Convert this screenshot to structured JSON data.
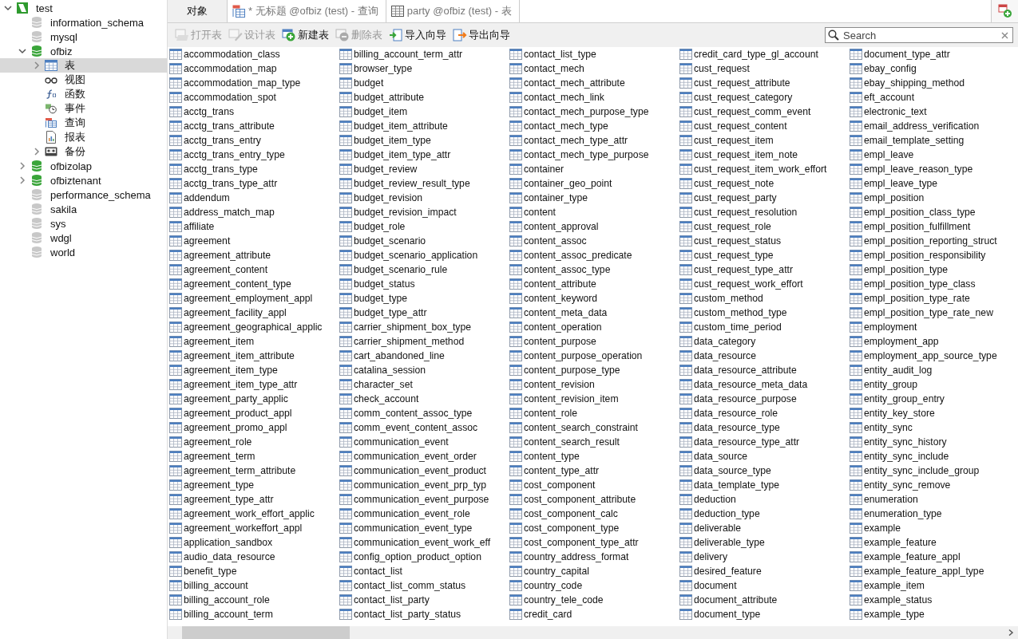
{
  "sidebar": {
    "tree": [
      {
        "label": "test",
        "kind": "connection",
        "expanded": true,
        "selected": false,
        "children": [
          {
            "label": "information_schema",
            "kind": "database",
            "connected": false,
            "selected": false
          },
          {
            "label": "mysql",
            "kind": "database",
            "connected": false,
            "selected": false
          },
          {
            "label": "ofbiz",
            "kind": "database",
            "connected": true,
            "expanded": true,
            "selected": false,
            "children": [
              {
                "label": "表",
                "kind": "tables",
                "expanded": false,
                "selected": true
              },
              {
                "label": "视图",
                "kind": "views",
                "selected": false
              },
              {
                "label": "函数",
                "kind": "functions",
                "selected": false
              },
              {
                "label": "事件",
                "kind": "events",
                "selected": false
              },
              {
                "label": "查询",
                "kind": "queries",
                "selected": false
              },
              {
                "label": "报表",
                "kind": "reports",
                "selected": false
              },
              {
                "label": "备份",
                "kind": "backups",
                "expanded": false,
                "selected": false
              }
            ]
          },
          {
            "label": "ofbizolap",
            "kind": "database",
            "connected": true,
            "expanded": false,
            "selected": false
          },
          {
            "label": "ofbiztenant",
            "kind": "database",
            "connected": true,
            "expanded": false,
            "selected": false
          },
          {
            "label": "performance_schema",
            "kind": "database",
            "connected": false,
            "selected": false
          },
          {
            "label": "sakila",
            "kind": "database",
            "connected": false,
            "selected": false
          },
          {
            "label": "sys",
            "kind": "database",
            "connected": false,
            "selected": false
          },
          {
            "label": "wdgl",
            "kind": "database",
            "connected": false,
            "selected": false
          },
          {
            "label": "world",
            "kind": "database",
            "connected": false,
            "selected": false
          }
        ]
      }
    ]
  },
  "tabs": [
    {
      "label": "对象",
      "kind": "objects",
      "selected": true
    },
    {
      "label": "* 无标题 @ofbiz (test) - 查询",
      "kind": "query",
      "selected": false
    },
    {
      "label": "party @ofbiz (test) - 表",
      "kind": "table",
      "selected": false
    }
  ],
  "toolbar": [
    {
      "label": "打开表",
      "kind": "open",
      "disabled": true
    },
    {
      "label": "设计表",
      "kind": "design",
      "disabled": true
    },
    {
      "label": "新建表",
      "kind": "new",
      "disabled": false
    },
    {
      "label": "删除表",
      "kind": "delete",
      "disabled": true
    },
    {
      "label": "导入向导",
      "kind": "import",
      "disabled": false
    },
    {
      "label": "导出向导",
      "kind": "export",
      "disabled": false
    }
  ],
  "search": {
    "placeholder": "Search"
  },
  "tables": [
    "accommodation_class",
    "accommodation_map",
    "accommodation_map_type",
    "accommodation_spot",
    "acctg_trans",
    "acctg_trans_attribute",
    "acctg_trans_entry",
    "acctg_trans_entry_type",
    "acctg_trans_type",
    "acctg_trans_type_attr",
    "addendum",
    "address_match_map",
    "affiliate",
    "agreement",
    "agreement_attribute",
    "agreement_content",
    "agreement_content_type",
    "agreement_employment_appl",
    "agreement_facility_appl",
    "agreement_geographical_applic",
    "agreement_item",
    "agreement_item_attribute",
    "agreement_item_type",
    "agreement_item_type_attr",
    "agreement_party_applic",
    "agreement_product_appl",
    "agreement_promo_appl",
    "agreement_role",
    "agreement_term",
    "agreement_term_attribute",
    "agreement_type",
    "agreement_type_attr",
    "agreement_work_effort_applic",
    "agreement_workeffort_appl",
    "application_sandbox",
    "audio_data_resource",
    "benefit_type",
    "billing_account",
    "billing_account_role",
    "billing_account_term",
    "billing_account_term_attr",
    "browser_type",
    "budget",
    "budget_attribute",
    "budget_item",
    "budget_item_attribute",
    "budget_item_type",
    "budget_item_type_attr",
    "budget_review",
    "budget_review_result_type",
    "budget_revision",
    "budget_revision_impact",
    "budget_role",
    "budget_scenario",
    "budget_scenario_application",
    "budget_scenario_rule",
    "budget_status",
    "budget_type",
    "budget_type_attr",
    "carrier_shipment_box_type",
    "carrier_shipment_method",
    "cart_abandoned_line",
    "catalina_session",
    "character_set",
    "check_account",
    "comm_content_assoc_type",
    "comm_event_content_assoc",
    "communication_event",
    "communication_event_order",
    "communication_event_product",
    "communication_event_prp_typ",
    "communication_event_purpose",
    "communication_event_role",
    "communication_event_type",
    "communication_event_work_eff",
    "config_option_product_option",
    "contact_list",
    "contact_list_comm_status",
    "contact_list_party",
    "contact_list_party_status",
    "contact_list_type",
    "contact_mech",
    "contact_mech_attribute",
    "contact_mech_link",
    "contact_mech_purpose_type",
    "contact_mech_type",
    "contact_mech_type_attr",
    "contact_mech_type_purpose",
    "container",
    "container_geo_point",
    "container_type",
    "content",
    "content_approval",
    "content_assoc",
    "content_assoc_predicate",
    "content_assoc_type",
    "content_attribute",
    "content_keyword",
    "content_meta_data",
    "content_operation",
    "content_purpose",
    "content_purpose_operation",
    "content_purpose_type",
    "content_revision",
    "content_revision_item",
    "content_role",
    "content_search_constraint",
    "content_search_result",
    "content_type",
    "content_type_attr",
    "cost_component",
    "cost_component_attribute",
    "cost_component_calc",
    "cost_component_type",
    "cost_component_type_attr",
    "country_address_format",
    "country_capital",
    "country_code",
    "country_tele_code",
    "credit_card",
    "credit_card_type_gl_account",
    "cust_request",
    "cust_request_attribute",
    "cust_request_category",
    "cust_request_comm_event",
    "cust_request_content",
    "cust_request_item",
    "cust_request_item_note",
    "cust_request_item_work_effort",
    "cust_request_note",
    "cust_request_party",
    "cust_request_resolution",
    "cust_request_role",
    "cust_request_status",
    "cust_request_type",
    "cust_request_type_attr",
    "cust_request_work_effort",
    "custom_method",
    "custom_method_type",
    "custom_time_period",
    "data_category",
    "data_resource",
    "data_resource_attribute",
    "data_resource_meta_data",
    "data_resource_purpose",
    "data_resource_role",
    "data_resource_type",
    "data_resource_type_attr",
    "data_source",
    "data_source_type",
    "data_template_type",
    "deduction",
    "deduction_type",
    "deliverable",
    "deliverable_type",
    "delivery",
    "desired_feature",
    "document",
    "document_attribute",
    "document_type",
    "document_type_attr",
    "ebay_config",
    "ebay_shipping_method",
    "eft_account",
    "electronic_text",
    "email_address_verification",
    "email_template_setting",
    "empl_leave",
    "empl_leave_reason_type",
    "empl_leave_type",
    "empl_position",
    "empl_position_class_type",
    "empl_position_fulfillment",
    "empl_position_reporting_struct",
    "empl_position_responsibility",
    "empl_position_type",
    "empl_position_type_class",
    "empl_position_type_rate",
    "empl_position_type_rate_new",
    "employment",
    "employment_app",
    "employment_app_source_type",
    "entity_audit_log",
    "entity_group",
    "entity_group_entry",
    "entity_key_store",
    "entity_sync",
    "entity_sync_history",
    "entity_sync_include",
    "entity_sync_include_group",
    "entity_sync_remove",
    "enumeration",
    "enumeration_type",
    "example",
    "example_feature",
    "example_feature_appl",
    "example_feature_appl_type",
    "example_item",
    "example_status",
    "example_type"
  ]
}
